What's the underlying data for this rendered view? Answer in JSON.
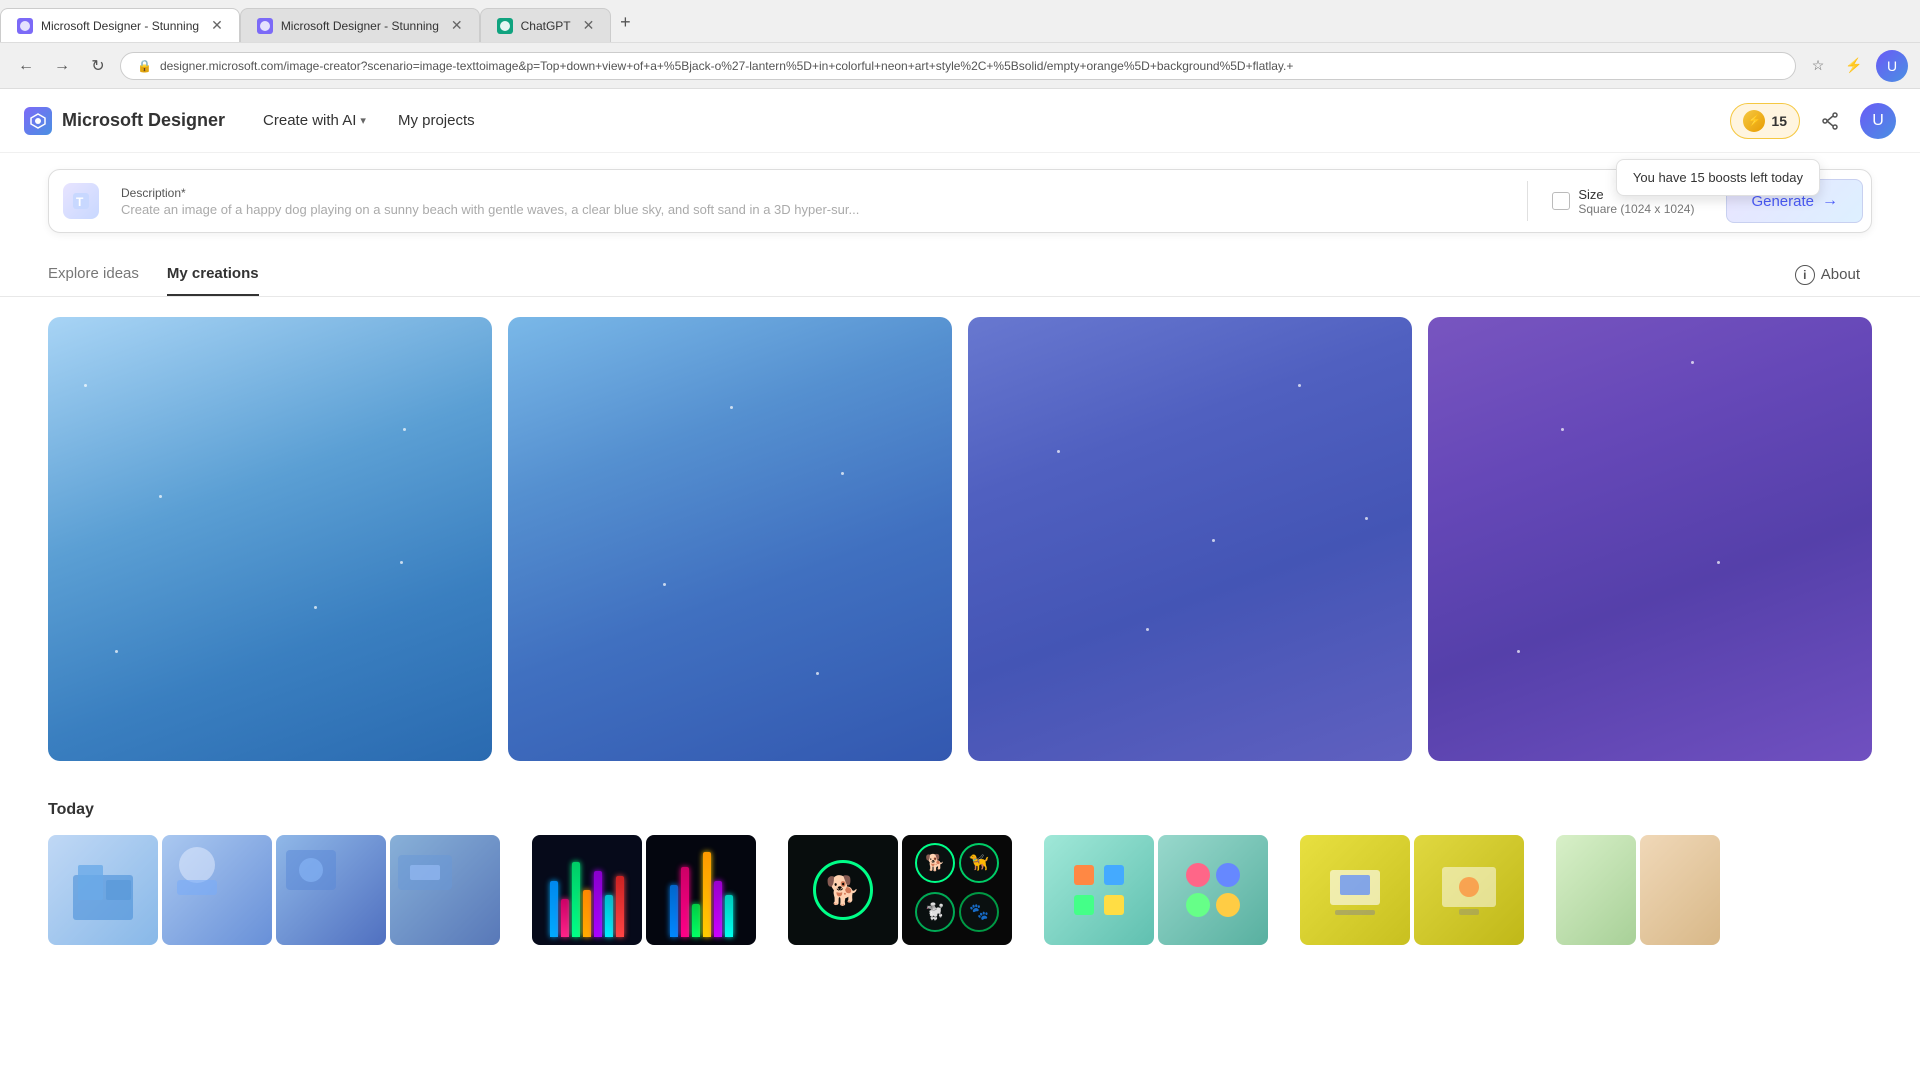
{
  "browser": {
    "tabs": [
      {
        "id": "tab1",
        "title": "Microsoft Designer - Stunning",
        "active": true,
        "favicon_color": "#7c6af7"
      },
      {
        "id": "tab2",
        "title": "Microsoft Designer - Stunning",
        "active": false,
        "favicon_color": "#7c6af7"
      },
      {
        "id": "tab3",
        "title": "ChatGPT",
        "active": false,
        "favicon_color": "#10a37f"
      }
    ],
    "url": "designer.microsoft.com/image-creator?scenario=image-texttoimage&p=Top+down+view+of+a+%5Bjack-o%27-lantern%5D+in+colorful+neon+art+style%2C+%5Bsolid/empty+orange%5D+background%5D+flatlay.+"
  },
  "navbar": {
    "brand_name": "Microsoft Designer",
    "create_ai_label": "Create with AI",
    "my_projects_label": "My projects",
    "boost_count": "15",
    "boost_tooltip": "You have 15 boosts left today"
  },
  "desc_bar": {
    "label": "Description*",
    "placeholder": "Create an image of a happy dog playing on a sunny beach with gentle waves, a clear blue sky, and soft sand in a 3D hyper-sur...",
    "size_label": "Size",
    "size_value": "Square (1024 x 1024)",
    "generate_label": "Generate"
  },
  "tabs": {
    "explore_label": "Explore ideas",
    "my_creations_label": "My creations",
    "about_label": "About"
  },
  "loading_cards": [
    {
      "id": "card1",
      "gradient": "card1"
    },
    {
      "id": "card2",
      "gradient": "card2"
    },
    {
      "id": "card3",
      "gradient": "card3"
    },
    {
      "id": "card4",
      "gradient": "card4"
    }
  ],
  "today": {
    "label": "Today",
    "thumbs": [
      {
        "type": "office",
        "count": 4
      },
      {
        "type": "neon",
        "count": 2
      },
      {
        "type": "dog",
        "count": 2
      },
      {
        "type": "colorful",
        "count": 2
      },
      {
        "type": "tech",
        "count": 2
      }
    ]
  }
}
